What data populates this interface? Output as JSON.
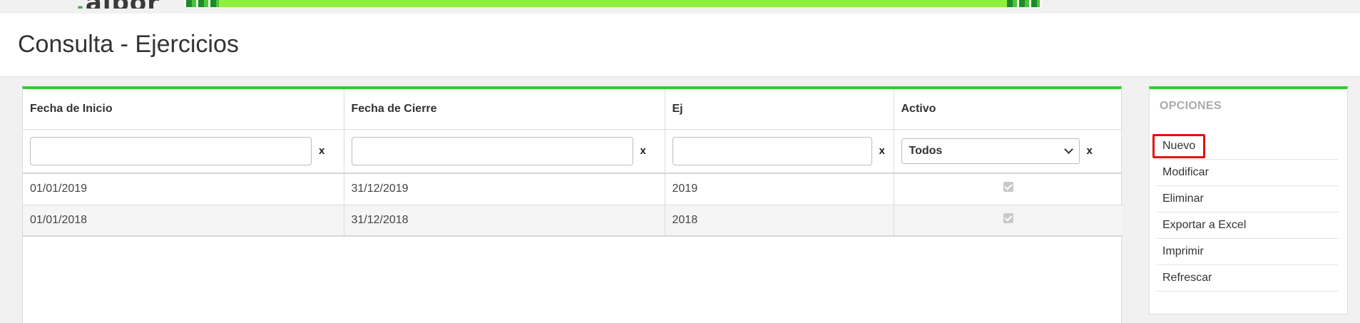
{
  "header": {
    "logo_text": "albor",
    "title": "Consulta - Ejercicios"
  },
  "grid": {
    "columns": [
      {
        "label": "Fecha de Inicio"
      },
      {
        "label": "Fecha de Cierre"
      },
      {
        "label": "Ej"
      },
      {
        "label": "Activo"
      }
    ],
    "filters": {
      "fecha_inicio": {
        "value": "",
        "placeholder": ""
      },
      "fecha_cierre": {
        "value": "",
        "placeholder": ""
      },
      "ej": {
        "value": "",
        "placeholder": ""
      },
      "activo": {
        "selected": "Todos"
      },
      "clear_label": "x"
    },
    "rows": [
      {
        "fecha_inicio": "01/01/2019",
        "fecha_cierre": "31/12/2019",
        "ej": "2019",
        "activo": true
      },
      {
        "fecha_inicio": "01/01/2018",
        "fecha_cierre": "31/12/2018",
        "ej": "2018",
        "activo": true
      }
    ]
  },
  "options": {
    "title": "OPCIONES",
    "items": [
      {
        "label": "Nuevo",
        "highlighted": true
      },
      {
        "label": "Modificar"
      },
      {
        "label": "Eliminar"
      },
      {
        "label": "Exportar a Excel"
      },
      {
        "label": "Imprimir"
      },
      {
        "label": "Refrescar"
      }
    ]
  },
  "colors": {
    "accent": "#2ecc2e",
    "banner": "#8ff03e",
    "highlight_border": "#e31010"
  }
}
